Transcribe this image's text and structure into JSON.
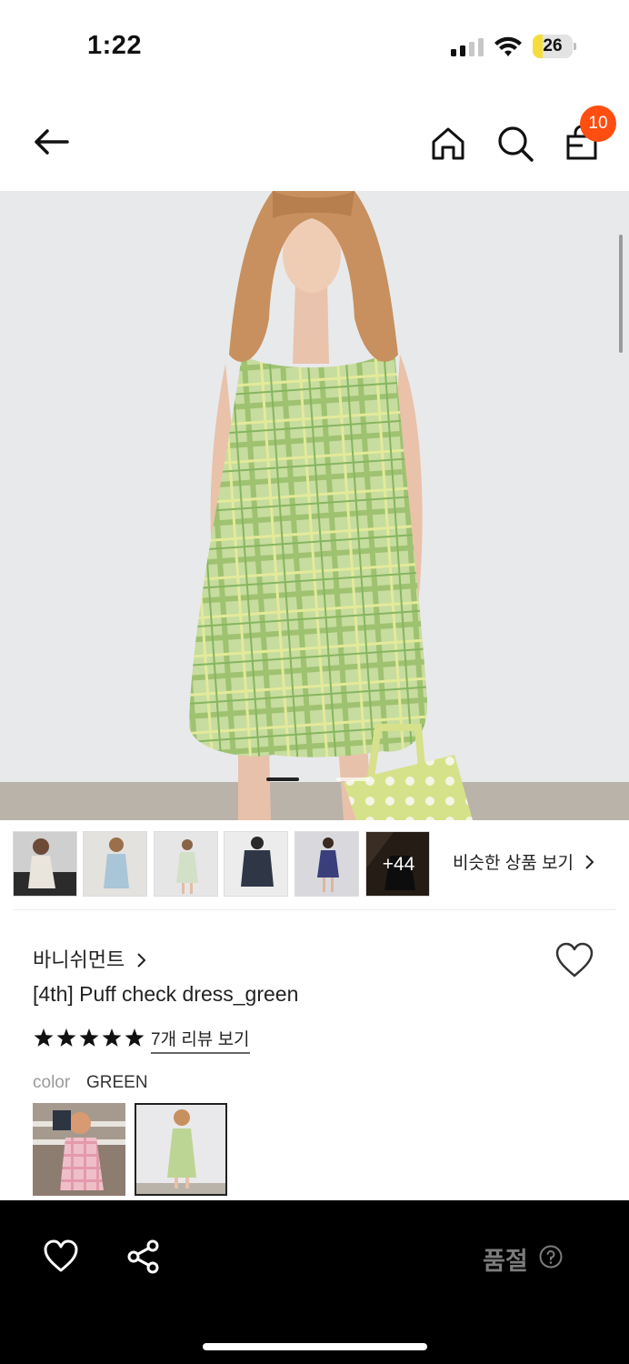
{
  "status_bar": {
    "time": "1:22",
    "battery": "26",
    "battery_level": 0.26
  },
  "nav": {
    "back_icon": "arrow-left-icon",
    "home_icon": "home-icon",
    "search_icon": "search-icon",
    "cart_icon": "shopping-bag-icon",
    "cart_count": "10"
  },
  "colors": {
    "accent": "#ff4e12",
    "dress_green": "#b9d48e",
    "soldout_text": "#7c7c7c"
  },
  "gallery": {
    "main_image_icon": "photo-model-green-check-dress"
  },
  "thumbnails": {
    "items": [
      "thumb-1",
      "thumb-2",
      "thumb-3",
      "thumb-4",
      "thumb-5"
    ],
    "more_label": "+44",
    "similar_label": "비슷한 상품 보기"
  },
  "product": {
    "brand": "바니쉬먼트",
    "title": "[4th] Puff check dress_green",
    "rating": 5,
    "reviews_label": "7개 리뷰 보기",
    "color_label": "color",
    "color_value": "GREEN"
  },
  "bottom_bar": {
    "soldout_label": "품절"
  }
}
